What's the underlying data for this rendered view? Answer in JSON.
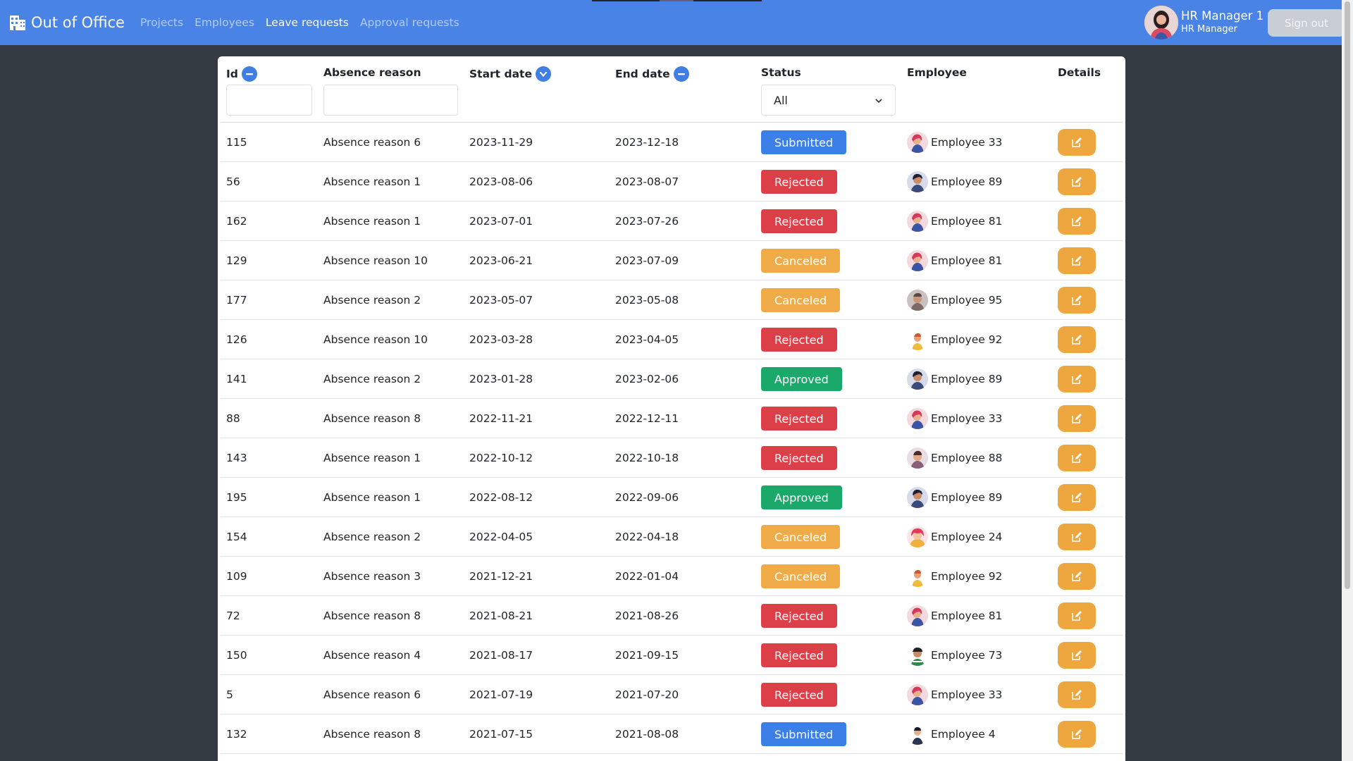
{
  "navbar": {
    "brand": "Out of Office",
    "links": [
      {
        "label": "Projects",
        "active": false
      },
      {
        "label": "Employees",
        "active": false
      },
      {
        "label": "Leave requests",
        "active": true
      },
      {
        "label": "Approval requests",
        "active": false
      }
    ],
    "user": {
      "name": "HR Manager 1",
      "role": "HR Manager"
    },
    "sign_out": "Sign out",
    "color": "#4a83e6"
  },
  "table": {
    "headers": {
      "id": "Id",
      "reason": "Absence reason",
      "start": "Start date",
      "end": "End date",
      "status": "Status",
      "employee": "Employee",
      "details": "Details"
    },
    "sort_icons": {
      "id": "minus-circle-icon",
      "start": "chevron-down-circle-icon",
      "end": "minus-circle-icon"
    },
    "status_filter": "All",
    "status_colors": {
      "Submitted": "#3c7fe6",
      "Rejected": "#dc3f47",
      "Canceled": "#efab47",
      "Approved": "#1aa96a"
    },
    "rows": [
      {
        "id": "115",
        "reason": "Absence reason 6",
        "start": "2023-11-29",
        "end": "2023-12-18",
        "status": "Submitted",
        "employee": "Employee 33",
        "avatar": "a"
      },
      {
        "id": "56",
        "reason": "Absence reason 1",
        "start": "2023-08-06",
        "end": "2023-08-07",
        "status": "Rejected",
        "employee": "Employee 89",
        "avatar": "b"
      },
      {
        "id": "162",
        "reason": "Absence reason 1",
        "start": "2023-07-01",
        "end": "2023-07-26",
        "status": "Rejected",
        "employee": "Employee 81",
        "avatar": "a"
      },
      {
        "id": "129",
        "reason": "Absence reason 10",
        "start": "2023-06-21",
        "end": "2023-07-09",
        "status": "Canceled",
        "employee": "Employee 81",
        "avatar": "a"
      },
      {
        "id": "177",
        "reason": "Absence reason 2",
        "start": "2023-05-07",
        "end": "2023-05-08",
        "status": "Canceled",
        "employee": "Employee 95",
        "avatar": "c"
      },
      {
        "id": "126",
        "reason": "Absence reason 10",
        "start": "2023-03-28",
        "end": "2023-04-05",
        "status": "Rejected",
        "employee": "Employee 92",
        "avatar": "d"
      },
      {
        "id": "141",
        "reason": "Absence reason 2",
        "start": "2023-01-28",
        "end": "2023-02-06",
        "status": "Approved",
        "employee": "Employee 89",
        "avatar": "b"
      },
      {
        "id": "88",
        "reason": "Absence reason 8",
        "start": "2022-11-21",
        "end": "2022-12-11",
        "status": "Rejected",
        "employee": "Employee 33",
        "avatar": "a"
      },
      {
        "id": "143",
        "reason": "Absence reason 1",
        "start": "2022-10-12",
        "end": "2022-10-18",
        "status": "Rejected",
        "employee": "Employee 88",
        "avatar": "e"
      },
      {
        "id": "195",
        "reason": "Absence reason 1",
        "start": "2022-08-12",
        "end": "2022-09-06",
        "status": "Approved",
        "employee": "Employee 89",
        "avatar": "b"
      },
      {
        "id": "154",
        "reason": "Absence reason 2",
        "start": "2022-04-05",
        "end": "2022-04-18",
        "status": "Canceled",
        "employee": "Employee 24",
        "avatar": "f"
      },
      {
        "id": "109",
        "reason": "Absence reason 3",
        "start": "2021-12-21",
        "end": "2022-01-04",
        "status": "Canceled",
        "employee": "Employee 92",
        "avatar": "d"
      },
      {
        "id": "72",
        "reason": "Absence reason 8",
        "start": "2021-08-21",
        "end": "2021-08-26",
        "status": "Rejected",
        "employee": "Employee 81",
        "avatar": "a"
      },
      {
        "id": "150",
        "reason": "Absence reason 4",
        "start": "2021-08-17",
        "end": "2021-09-15",
        "status": "Rejected",
        "employee": "Employee 73",
        "avatar": "g"
      },
      {
        "id": "5",
        "reason": "Absence reason 6",
        "start": "2021-07-19",
        "end": "2021-07-20",
        "status": "Rejected",
        "employee": "Employee 33",
        "avatar": "a"
      },
      {
        "id": "132",
        "reason": "Absence reason 8",
        "start": "2021-07-15",
        "end": "2021-08-08",
        "status": "Submitted",
        "employee": "Employee 4",
        "avatar": "h"
      }
    ]
  }
}
